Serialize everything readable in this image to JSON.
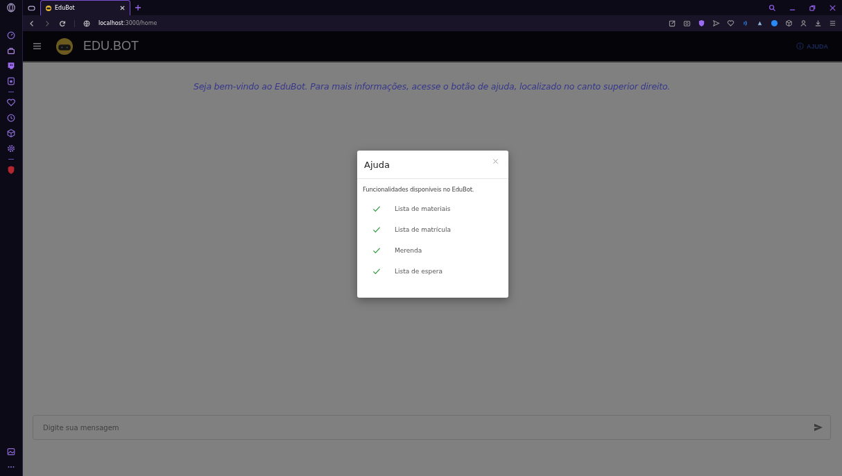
{
  "browser": {
    "tabs": [
      {
        "title": "EduBot",
        "selected": true
      }
    ],
    "url_host": "localhost",
    "url_path": ":3000/home"
  },
  "header": {
    "brand": "EDU.BOT",
    "help_button": "AJUDA"
  },
  "welcome": "Seja bem-vindo ao EduBot. Para mais informações, acesse o botão de ajuda, localizado no canto superior direito.",
  "dialog": {
    "title": "Ajuda",
    "intro": "Funcionalidades disponíveis no EduBot.",
    "items": [
      {
        "label": "Lista de materiais"
      },
      {
        "label": "Lista de matrícula"
      },
      {
        "label": "Merenda"
      },
      {
        "label": "Lista de espera"
      }
    ]
  },
  "message_field": {
    "placeholder": "Digite sua mensagem"
  }
}
